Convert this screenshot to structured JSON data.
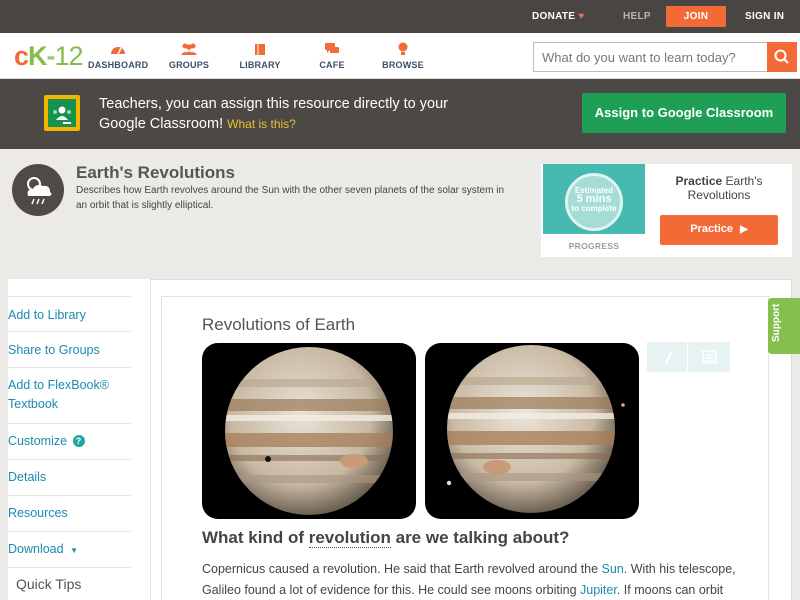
{
  "topbar": {
    "donate": "DONATE",
    "help": "HELP",
    "join": "JOIN",
    "signin": "SIGN IN"
  },
  "nav": {
    "logo": {
      "c": "c",
      "k": "K",
      "dash": "-",
      "n": "12"
    },
    "items": [
      {
        "label": "DASHBOARD",
        "icon": "dashboard-icon"
      },
      {
        "label": "GROUPS",
        "icon": "groups-icon"
      },
      {
        "label": "LIBRARY",
        "icon": "library-icon"
      },
      {
        "label": "CAFE",
        "icon": "cafe-icon"
      },
      {
        "label": "BROWSE",
        "icon": "browse-icon"
      }
    ],
    "search_placeholder": "What do you want to learn today?"
  },
  "classroom": {
    "text": "Teachers, you can assign this resource directly to your Google Classroom!",
    "what": "What is this?",
    "button": "Assign to Google Classroom"
  },
  "concept": {
    "title": "Earth's Revolutions",
    "description": "Describes how Earth revolves around the Sun with the other seven planets of the solar system in an orbit that is slightly elliptical."
  },
  "practice": {
    "estimated_line1": "Estimated",
    "estimated_minutes": "5 mins",
    "estimated_line3": "to complete",
    "progress_label": "PROGRESS",
    "title_bold": "Practice",
    "title_rest": "Earth's Revolutions",
    "button": "Practice"
  },
  "sidebar": {
    "items": [
      "Add to Library",
      "Share to Groups",
      "Add to FlexBook® Textbook",
      "Customize",
      "Details",
      "Resources",
      "Download"
    ],
    "quick_tips": "Quick Tips"
  },
  "content": {
    "title": "Revolutions of Earth",
    "question_pre": "What kind of ",
    "question_word": "revolution",
    "question_post": " are we talking about?",
    "para_1": "Copernicus caused a revolution. He said that Earth revolved around the ",
    "para_sun": "Sun",
    "para_2": ". With his telescope, Galileo found a lot of evidence for this. He could see moons orbiting ",
    "para_jupiter": "Jupiter",
    "para_3": ". If moons can orbit"
  },
  "support": "Support",
  "colors": {
    "accent": "#f26a35",
    "brand_green": "#86bd4a",
    "classroom_green": "#1f9f56",
    "link": "#1b8bb0"
  }
}
